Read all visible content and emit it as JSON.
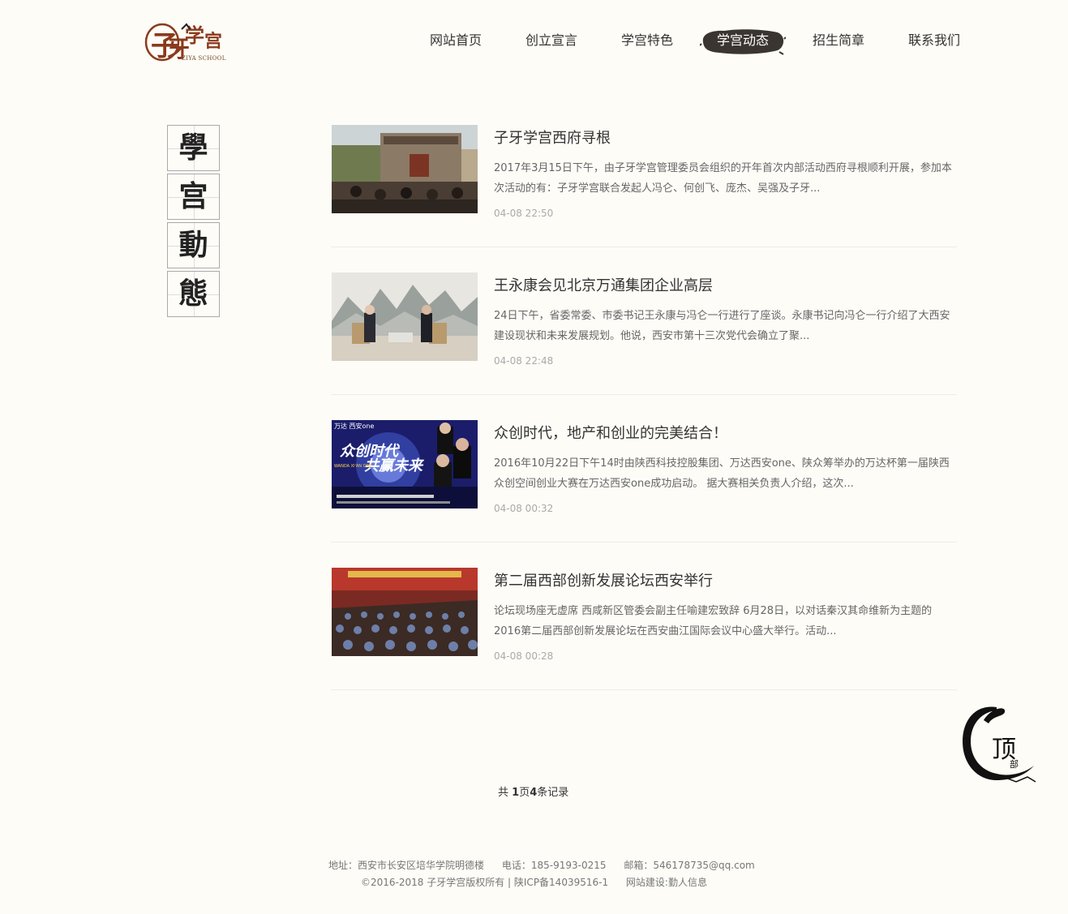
{
  "header": {
    "logo_text": "ZIYA SCHOOL",
    "logo_glyphs": "子牙学宫",
    "nav": [
      {
        "label": "网站首页",
        "active": false
      },
      {
        "label": "创立宣言",
        "active": false
      },
      {
        "label": "学宫特色",
        "active": false
      },
      {
        "label": "学宫动态",
        "active": true
      },
      {
        "label": "招生简章",
        "active": false
      },
      {
        "label": "联系我们",
        "active": false
      }
    ]
  },
  "side_title": [
    "學",
    "宫",
    "動",
    "態"
  ],
  "news": [
    {
      "title": "子牙学宫西府寻根",
      "desc": "2017年3月15日下午，由子牙学宫管理委员会组织的开年首次内部活动西府寻根顺利开展，参加本次活动的有：子牙学宫联合发起人冯仑、何创飞、庞杰、吴强及子牙...",
      "date": "04-08 22:50"
    },
    {
      "title": "王永康会见北京万通集团企业高层",
      "desc": "24日下午，省委常委、市委书记王永康与冯仑一行进行了座谈。永康书记向冯仑一行介绍了大西安建设现状和未来发展规划。他说，西安市第十三次党代会确立了聚...",
      "date": "04-08 22:48"
    },
    {
      "title": "众创时代，地产和创业的完美结合！",
      "desc": "2016年10月22日下午14时由陕西科技控股集团、万达西安one、陕众筹举办的万达杯第一届陕西众创空间创业大赛在万达西安one成功启动。 据大赛相关负责人介绍，这次...",
      "date": "04-08 00:32"
    },
    {
      "title": "第二届西部创新发展论坛西安举行",
      "desc": "论坛现场座无虚席 西咸新区管委会副主任喻建宏致辞 6月28日，以对话秦汉其命维新为主题的2016第二届西部创新发展论坛在西安曲江国际会议中心盛大举行。活动...",
      "date": "04-08 00:28"
    }
  ],
  "thumb3_text": {
    "brand": "万达 西安one",
    "headline1": "众创时代",
    "headline2": "共赢未来",
    "sub": "WANDA XI'AN ONE"
  },
  "pager": {
    "prefix": "共 ",
    "pages": "1",
    "mid": "页",
    "records": "4",
    "suffix": "条记录"
  },
  "footer": {
    "address": "地址：西安市长安区培华学院明德楼",
    "phone": "电话：185-9193-0215",
    "email": "邮箱：546178735@qq.com",
    "copyright": "©2016-2018 子牙学宫版权所有 | 陕ICP备14039516-1",
    "builder": "网站建设:勤人信息"
  },
  "to_top": {
    "big": "顶",
    "small": "部"
  },
  "colors": {
    "background": "#fdfcf7",
    "ink": "#3a3530",
    "logo_brown": "#8a3a1c"
  }
}
